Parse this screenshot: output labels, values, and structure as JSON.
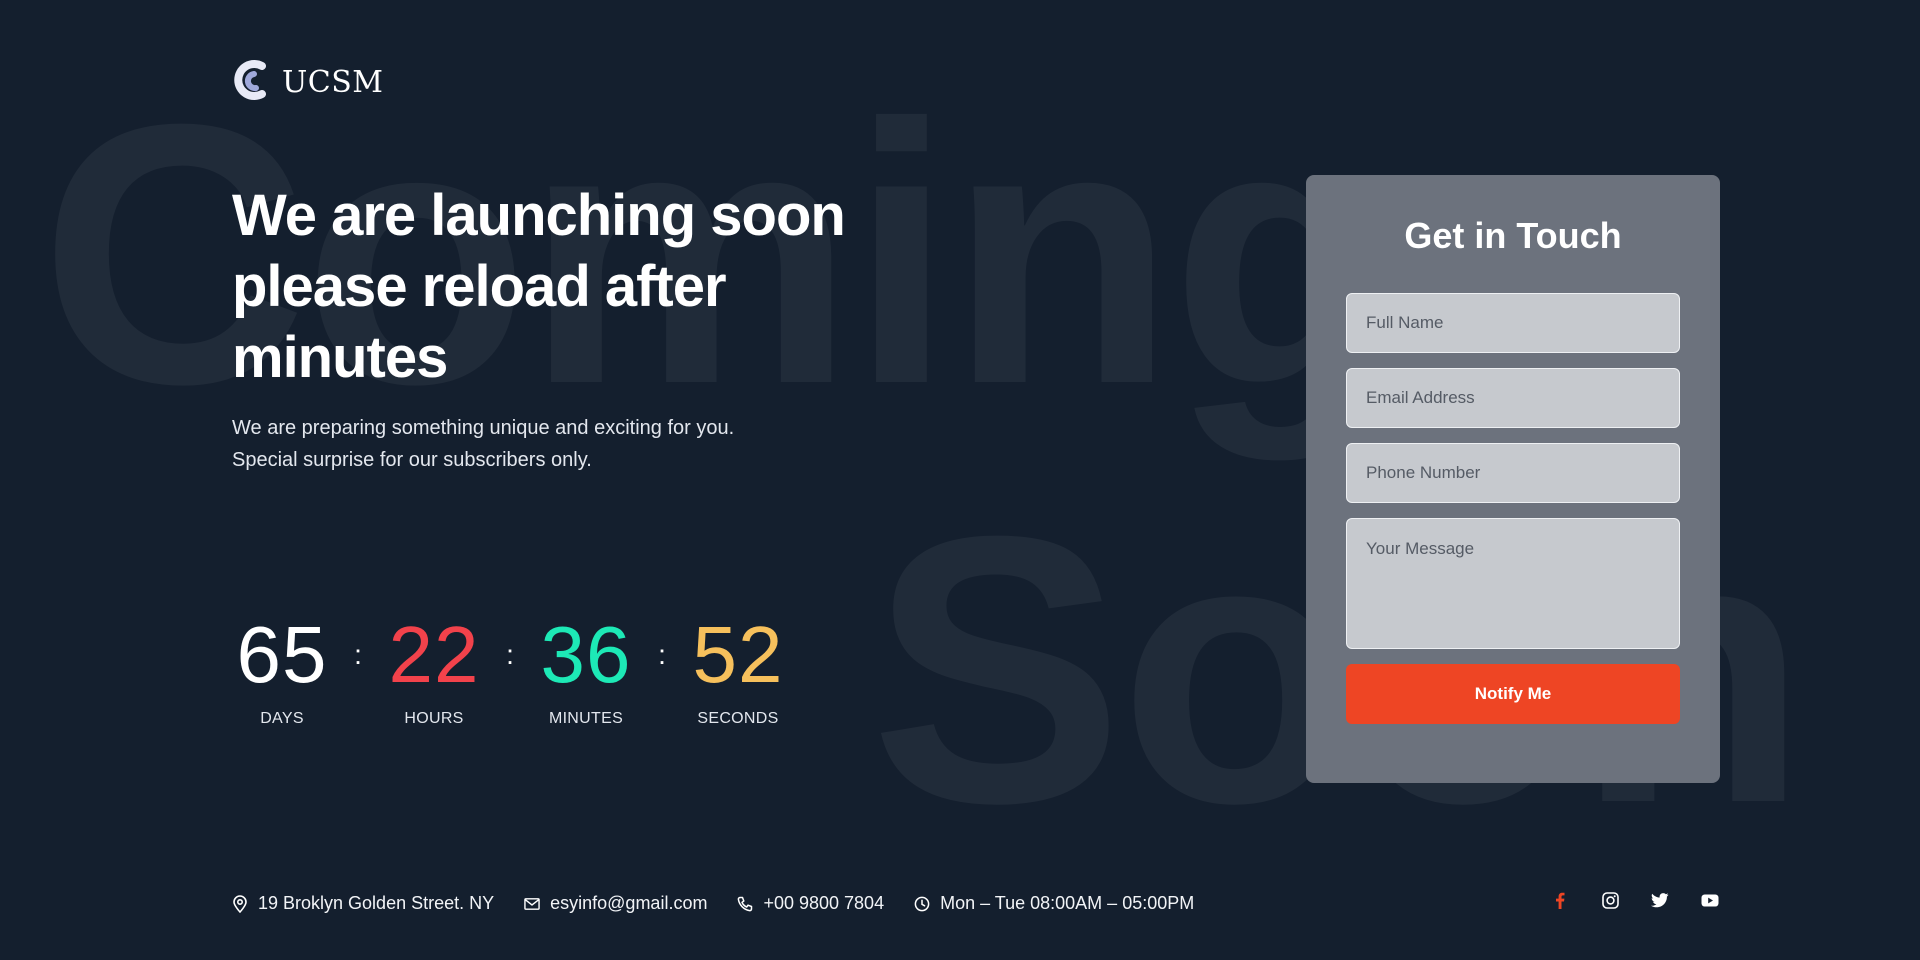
{
  "background": {
    "word1": "Coming",
    "word2": "Soon"
  },
  "brand": {
    "name": "UCSM",
    "logo_icon": "ucsm-logo-mark"
  },
  "hero": {
    "title": "We are launching soon please reload after minutes",
    "subtitle_lines": [
      "We are preparing something unique and exciting for you.",
      "Special surprise for our subscribers only."
    ]
  },
  "countdown": {
    "separator": ":",
    "units": [
      {
        "value": "65",
        "label": "DAYS",
        "color": "#ffffff"
      },
      {
        "value": "22",
        "label": "HOURS",
        "color": "#f2424b"
      },
      {
        "value": "36",
        "label": "MINUTES",
        "color": "#1de9b6"
      },
      {
        "value": "52",
        "label": "SECONDS",
        "color": "#f6c05c"
      }
    ]
  },
  "contact_form": {
    "title": "Get in Touch",
    "fields": {
      "full_name": {
        "placeholder": "Full Name",
        "value": ""
      },
      "email": {
        "placeholder": "Email Address",
        "value": ""
      },
      "phone": {
        "placeholder": "Phone Number",
        "value": ""
      },
      "message": {
        "placeholder": "Your Message",
        "value": ""
      }
    },
    "submit_label": "Notify Me",
    "submit_color": "#ee4524"
  },
  "footer": {
    "address": {
      "icon": "location-pin-icon",
      "text": "19 Broklyn Golden Street. NY"
    },
    "email": {
      "icon": "envelope-icon",
      "text": "esyinfo@gmail.com"
    },
    "phone": {
      "icon": "phone-icon",
      "text": "+00 9800 7804"
    },
    "hours": {
      "icon": "clock-icon",
      "text": "Mon – Tue 08:00AM – 05:00PM"
    },
    "socials": [
      {
        "name": "facebook",
        "icon": "facebook-icon",
        "color": "#ee4524"
      },
      {
        "name": "instagram",
        "icon": "instagram-icon",
        "color": "#ffffff"
      },
      {
        "name": "twitter",
        "icon": "twitter-icon",
        "color": "#ffffff"
      },
      {
        "name": "youtube",
        "icon": "youtube-icon",
        "color": "#ffffff"
      }
    ]
  },
  "colors": {
    "background": "#141f2e",
    "card": "#6c727d",
    "accent": "#ee4524"
  }
}
